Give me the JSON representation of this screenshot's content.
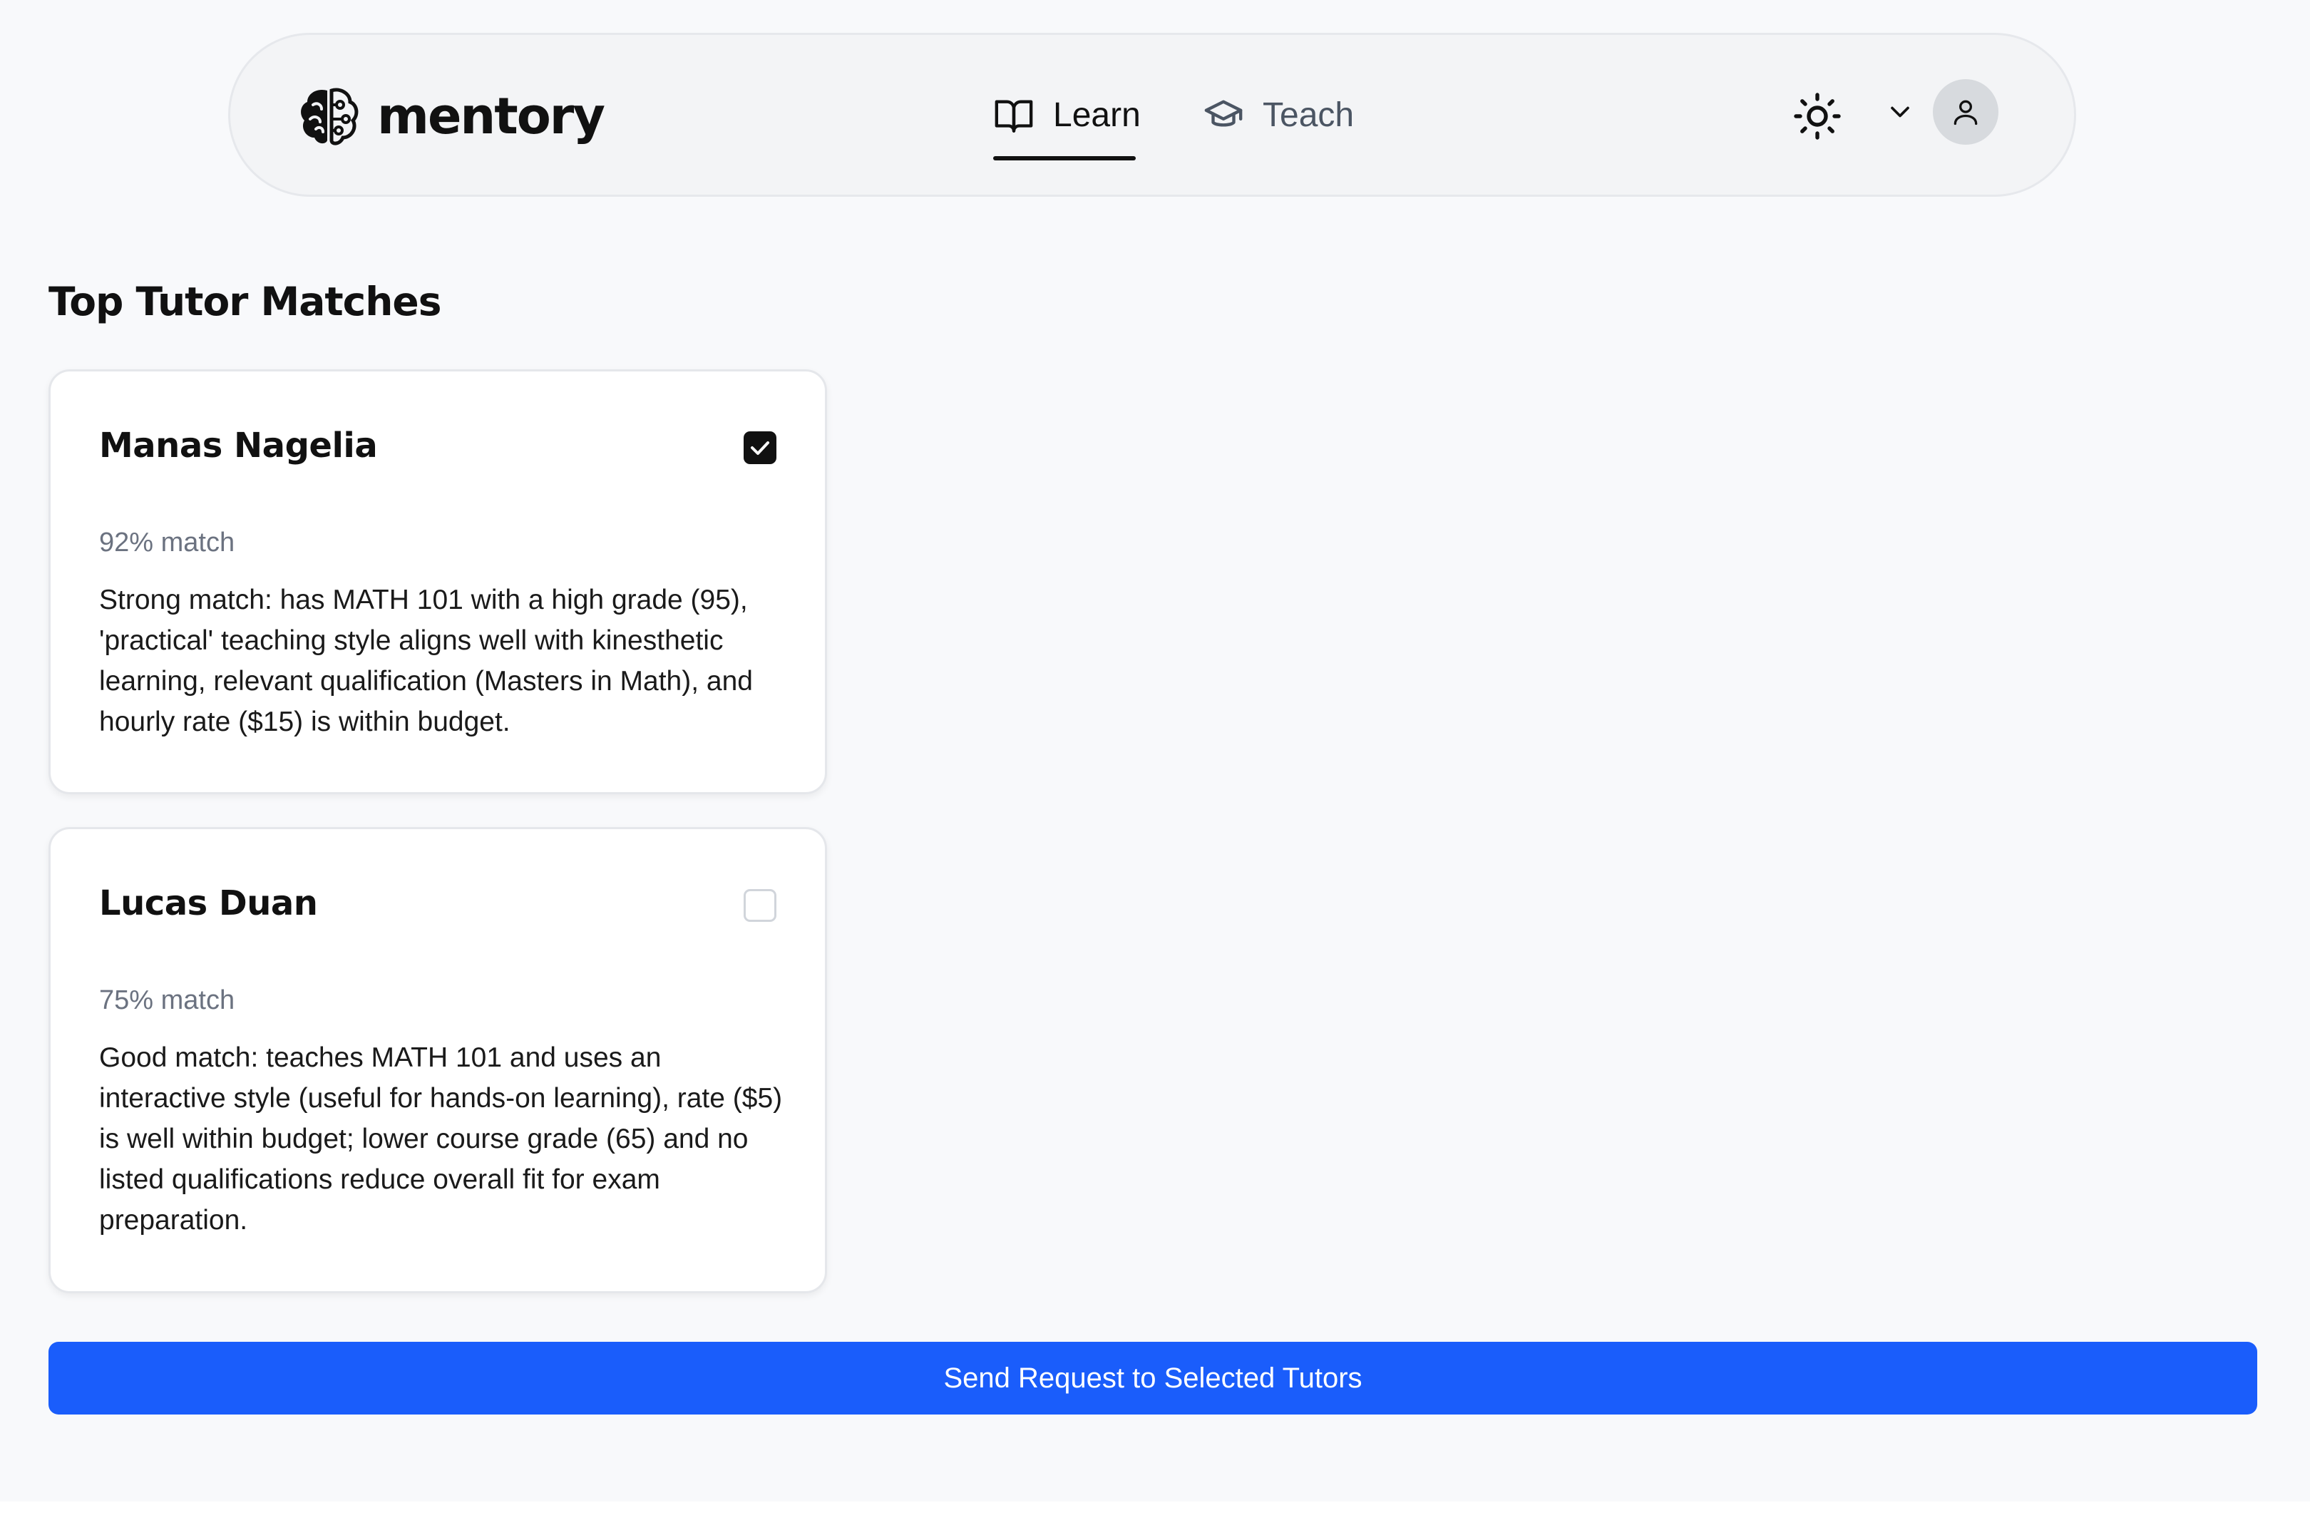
{
  "header": {
    "logo_text": "mentory",
    "nav": [
      {
        "label": "Learn",
        "icon": "book-open-icon",
        "active": true
      },
      {
        "label": "Teach",
        "icon": "graduation-cap-icon",
        "active": false
      }
    ],
    "theme_icon": "sun-icon",
    "user_menu_icon": "chevron-down-icon",
    "avatar_icon": "user-icon"
  },
  "main": {
    "title": "Top Tutor Matches",
    "tutors": [
      {
        "name": "Manas Nagelia",
        "selected": true,
        "match": "92% match",
        "reason": "Strong match: has MATH 101 with a high grade (95), 'practical' teaching style aligns well with kinesthetic learning, relevant qualification (Masters in Math), and hourly rate ($15) is within budget."
      },
      {
        "name": "Lucas Duan",
        "selected": false,
        "match": "75% match",
        "reason": "Good match: teaches MATH 101 and uses an interactive style (useful for hands-on learning), rate ($5) is well within budget; lower course grade (65) and no listed qualifications reduce overall fit for exam preparation."
      }
    ],
    "send_button_label": "Send Request to Selected Tutors"
  },
  "colors": {
    "primary": "#1a5dfb",
    "page_background": "#f8f9fb",
    "header_background": "#f3f4f6",
    "text": "#111111",
    "muted_text": "#6b7280"
  }
}
